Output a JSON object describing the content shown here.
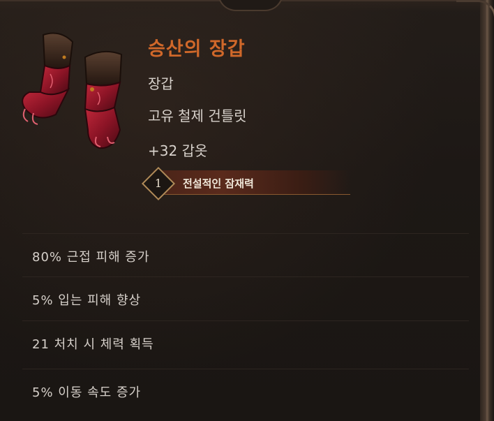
{
  "item": {
    "name": "승산의 장갑",
    "slot": "장갑",
    "base_type": "고유 철제 건틀릿",
    "armor": "+32 갑옷",
    "icon": "gauntlets-icon",
    "colors": {
      "name": "#d0682a",
      "text": "#d8d2cc",
      "background": "#1d1815"
    }
  },
  "rank": {
    "number": "1",
    "label": "전설적인 잠재력"
  },
  "affixes": [
    {
      "text": "80% 근접 피해 증가"
    },
    {
      "text": "5% 입는 피해 향상"
    },
    {
      "text": "21 처치 시 체력 획득"
    },
    {
      "text": "5% 이동 속도 증가"
    }
  ]
}
